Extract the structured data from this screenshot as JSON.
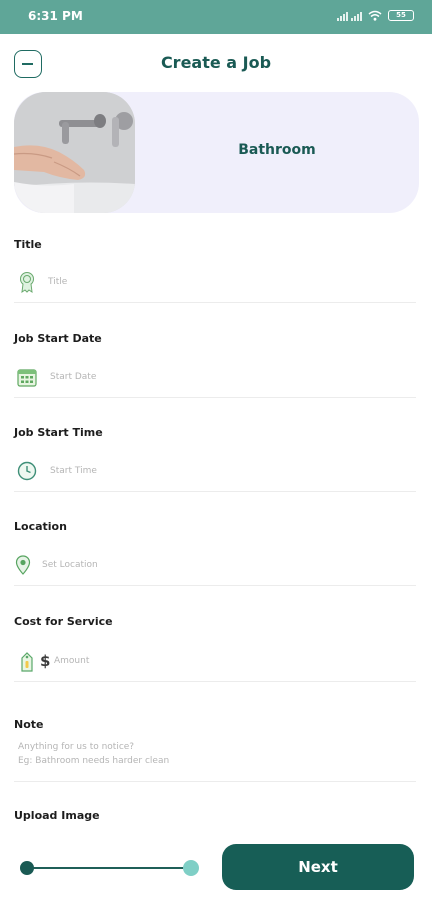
{
  "status_bar": {
    "time": "6:31 PM",
    "battery": "55"
  },
  "header": {
    "title": "Create a Job"
  },
  "category": {
    "label": "Bathroom"
  },
  "form": {
    "title": {
      "label": "Title",
      "placeholder": "Title"
    },
    "start_date": {
      "label": "Job Start Date",
      "placeholder": "Start Date"
    },
    "start_time": {
      "label": "Job Start Time",
      "placeholder": "Start Time"
    },
    "location": {
      "label": "Location",
      "placeholder": "Set Location"
    },
    "cost": {
      "label": "Cost for Service",
      "currency": "$",
      "placeholder": "Amount"
    },
    "note": {
      "label": "Note",
      "placeholder_line1": "Anything for us to notice?",
      "placeholder_line2": "Eg: Bathroom needs harder clean"
    },
    "upload": {
      "label": "Upload Image"
    }
  },
  "footer": {
    "next_label": "Next",
    "progress_fraction": 0.5
  },
  "colors": {
    "primary": "#175e56",
    "status_bar": "#5fa698",
    "card_bg": "#f0effb",
    "accent": "#7fcfc6",
    "icon_green": "#4caf50"
  }
}
